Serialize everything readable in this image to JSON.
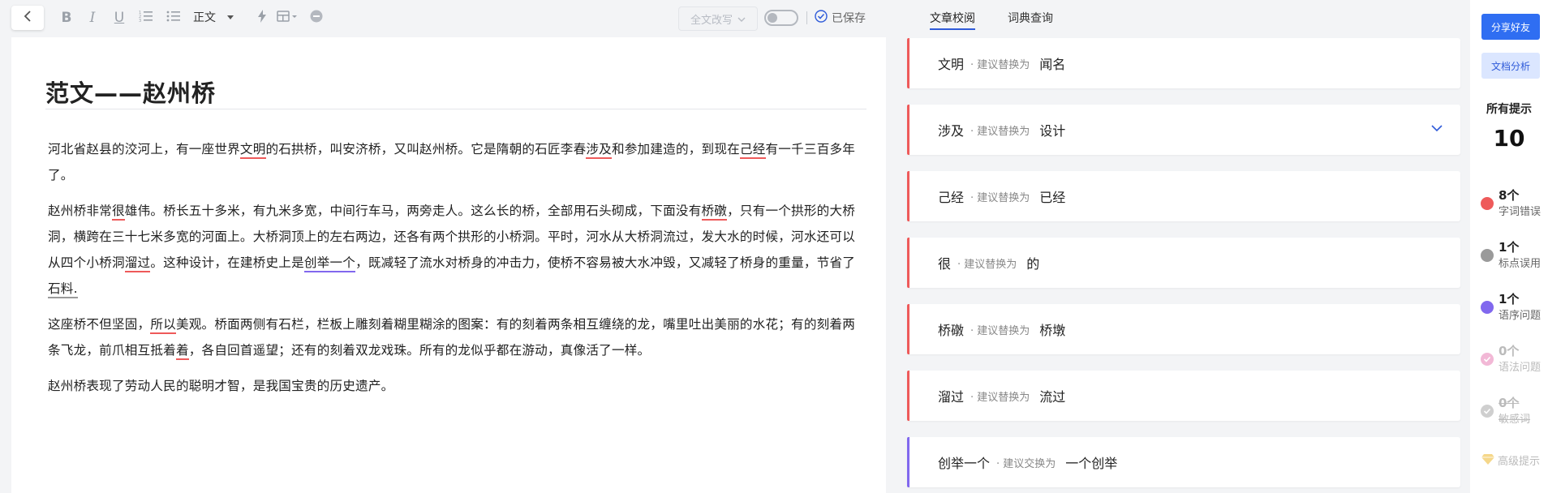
{
  "toolbar": {
    "back_icon": "chevron-left-icon",
    "bold_icon": "B",
    "italic_icon": "I",
    "underline_icon": "U",
    "ordered_list_icon": "ordered-list-icon",
    "bullet_list_icon": "bullet-list-icon",
    "paragraph_style": "正文",
    "quick_icon": "lightning-icon",
    "layout_icon": "layout-icon",
    "more_icon": "more-icon",
    "rewrite_label": "全文改写",
    "toggle_on": false,
    "saved_label": "已保存"
  },
  "document": {
    "title": "范文——赵州桥",
    "paragraphs": [
      [
        {
          "t": "河北省赵县的洨河上，有一座世界"
        },
        {
          "t": "文明",
          "u": "red"
        },
        {
          "t": "的石拱桥，叫安济桥，又叫赵州桥。它是隋朝的石匠李春"
        },
        {
          "t": "涉及",
          "u": "red"
        },
        {
          "t": "和参加建造的，到现在"
        },
        {
          "t": "己经",
          "u": "red"
        },
        {
          "t": "有一千三百多年了。"
        }
      ],
      [
        {
          "t": "赵州桥非常"
        },
        {
          "t": "很",
          "u": "red"
        },
        {
          "t": "雄伟。桥长五十多米，有九米多宽，中间行车马，两旁走人。这么长的桥，全部用石头砌成，下面没有"
        },
        {
          "t": "桥礅",
          "u": "red"
        },
        {
          "t": "，只有一个拱形的大桥洞，横跨在三十七米多宽的河面上。大桥洞顶上的左右两边，还各有两个拱形的小桥洞。平时，河水从大桥洞流过，发大水的时候，河水还可以从四个小桥洞"
        },
        {
          "t": "溜过",
          "u": "red"
        },
        {
          "t": "。这种设计，在建桥史上是"
        },
        {
          "t": "创举一个",
          "u": "purple"
        },
        {
          "t": "，既减轻了流水对桥身的冲击力，使桥不容易被大水冲毁，又减轻了桥身的重量，节省了"
        },
        {
          "t": "石料.",
          "u": "gray"
        }
      ],
      [
        {
          "t": "这座桥不但坚固，"
        },
        {
          "t": "所以",
          "u": "red"
        },
        {
          "t": "美观。桥面两侧有石栏，栏板上雕刻着糊里糊涂的图案：有的刻着两条相互缠绕的龙，嘴里吐出美丽的水花；有的刻着两条飞龙，前爪相互抵着"
        },
        {
          "t": "着",
          "u": "red"
        },
        {
          "t": "，各自回首遥望；还有的刻着双龙戏珠。所有的龙似乎都在游动，真像活了一样。"
        }
      ],
      [
        {
          "t": "赵州桥表现了劳动人民的聪明才智，是我国宝贵的历史遗产。"
        }
      ]
    ]
  },
  "panel": {
    "tabs": [
      {
        "label": "文章校阅",
        "active": true
      },
      {
        "label": "词典查询",
        "active": false
      }
    ],
    "cards": [
      {
        "word": "文明",
        "hint": "· 建议替换为",
        "suggestion": "闻名",
        "color": "#ee5a5a",
        "expanded": false
      },
      {
        "word": "涉及",
        "hint": "· 建议替换为",
        "suggestion": "设计",
        "color": "#ee5a5a",
        "expanded": true
      },
      {
        "word": "己经",
        "hint": "· 建议替换为",
        "suggestion": "已经",
        "color": "#ee5a5a",
        "expanded": false
      },
      {
        "word": "很",
        "hint": "· 建议替换为",
        "suggestion": "的",
        "color": "#ee5a5a",
        "expanded": false
      },
      {
        "word": "桥礅",
        "hint": "· 建议替换为",
        "suggestion": "桥墩",
        "color": "#ee5a5a",
        "expanded": false
      },
      {
        "word": "溜过",
        "hint": "· 建议替换为",
        "suggestion": "流过",
        "color": "#ee5a5a",
        "expanded": false
      },
      {
        "word": "创举一个",
        "hint": "· 建议交换为",
        "suggestion": "一个创举",
        "color": "#8168ee",
        "expanded": false
      }
    ]
  },
  "sidebar": {
    "share_label": "分享好友",
    "analysis_label": "文档分析",
    "all_hints_label": "所有提示",
    "total": "10",
    "stats": [
      {
        "count": "8个",
        "label": "字词错误",
        "color": "#ee5a5a",
        "faded": false
      },
      {
        "count": "1个",
        "label": "标点误用",
        "color": "#9a9a9a",
        "faded": false
      },
      {
        "count": "1个",
        "label": "语序问题",
        "color": "#8168ee",
        "faded": false
      },
      {
        "count": "0个",
        "label": "语法问题",
        "color": "#f2b8d6",
        "faded": true
      },
      {
        "count": "0个",
        "label": "敏感词",
        "color": "#cfcfcf",
        "faded": true
      }
    ],
    "advanced_label": "高级提示",
    "advanced_icon": "diamond-icon"
  }
}
